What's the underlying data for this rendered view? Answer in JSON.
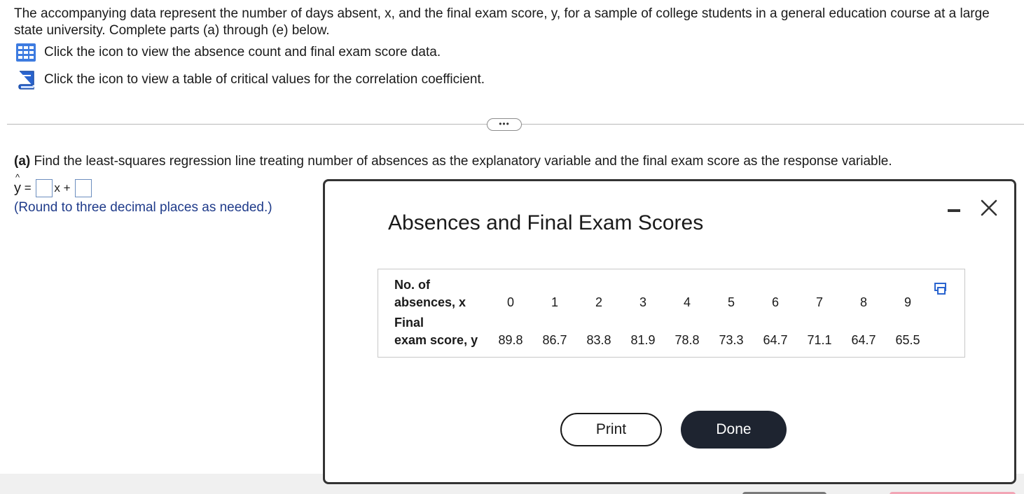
{
  "intro_text": "The accompanying data represent the number of days absent, x, and the final exam score, y, for a sample of college students in a general education course at a large state university. Complete parts (a) through (e) below.",
  "links": [
    {
      "icon": "grid-table-icon",
      "label": "Click the icon to view the absence count and final exam score data."
    },
    {
      "icon": "book-icon",
      "label": "Click the icon to view a table of critical values for the correlation coefficient."
    }
  ],
  "more_button": "•••",
  "part_a": {
    "prefix": "(a)",
    "question": " Find the least-squares regression line treating number of absences as the explanatory variable and the final exam score as the response variable.",
    "equation": {
      "lhs": "y",
      "equals": " = ",
      "x_plus": "x + "
    },
    "note": "(Round to three decimal places as needed.)"
  },
  "modal": {
    "title": "Absences and Final Exam Scores",
    "minimize_icon": "minimize-icon",
    "close_icon": "close-icon",
    "table": {
      "x_label_line1": "No. of",
      "x_label_line2": "absences, x",
      "y_label_line1": "Final",
      "y_label_line2": "exam score, y",
      "x_values": [
        "0",
        "1",
        "2",
        "3",
        "4",
        "5",
        "6",
        "7",
        "8",
        "9"
      ],
      "y_values": [
        "89.8",
        "86.7",
        "83.8",
        "81.9",
        "78.8",
        "73.3",
        "64.7",
        "71.1",
        "64.7",
        "65.5"
      ]
    },
    "print_label": "Print",
    "done_label": "Done"
  },
  "colors": {
    "note_text": "#1f3b8a",
    "done_button": "#1e2430",
    "answer_box_border": "#6c8ebf"
  }
}
